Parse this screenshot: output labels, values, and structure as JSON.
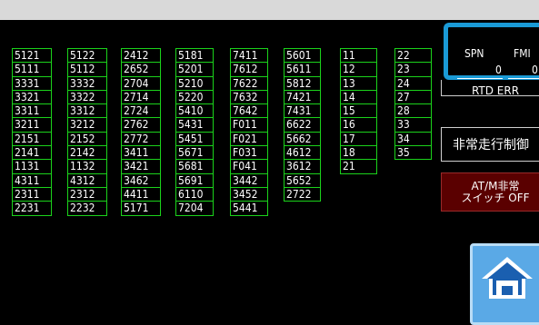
{
  "columns": [
    [
      "5121",
      "5111",
      "3331",
      "3321",
      "3311",
      "3211",
      "2151",
      "2141",
      "1131",
      "4311",
      "2311",
      "2231"
    ],
    [
      "5122",
      "5112",
      "3332",
      "3322",
      "3312",
      "3212",
      "2152",
      "2142",
      "1132",
      "4312",
      "2312",
      "2232"
    ],
    [
      "2412",
      "2652",
      "2704",
      "2714",
      "2724",
      "2762",
      "2772",
      "3411",
      "3421",
      "3462",
      "4411",
      "5171"
    ],
    [
      "5181",
      "5201",
      "5210",
      "5220",
      "5410",
      "5431",
      "5451",
      "5671",
      "5681",
      "5691",
      "6110",
      "7204"
    ],
    [
      "7411",
      "7612",
      "7622",
      "7632",
      "7642",
      "F011",
      "F021",
      "F031",
      "F041",
      "3442",
      "3452",
      "5441"
    ],
    [
      "5601",
      "5611",
      "5812",
      "7421",
      "7431",
      "6622",
      "5662",
      "4612",
      "3612",
      "5652",
      "2722"
    ],
    [
      "11",
      "12",
      "13",
      "14",
      "15",
      "16",
      "17",
      "18",
      "21"
    ],
    [
      "22",
      "23",
      "24",
      "27",
      "28",
      "33",
      "34",
      "35"
    ]
  ],
  "spn": {
    "label": "SPN",
    "value": "0"
  },
  "fmi": {
    "label": "FMI",
    "value": "0"
  },
  "buttons": {
    "rtd_err": "RTD ERR",
    "emergency": "非常走行制御",
    "atm_line1": "AT/M非常",
    "atm_line2": "スイッチ OFF"
  },
  "colors": {
    "cell_border": "#1bd31b",
    "spn_border": "#1a9ad6",
    "home_bg": "#5aa9e6",
    "atm_bg": "#5a0000"
  }
}
